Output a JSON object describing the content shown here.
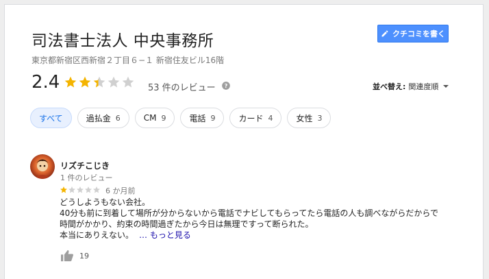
{
  "business": {
    "name": "司法書士法人 中央事務所",
    "address": "東京都新宿区西新宿２丁目６−１ 新宿住友ビル16階",
    "write_review_label": "クチコミを書く",
    "rating": "2.4",
    "rating_value": 2.4,
    "rating_max": 5,
    "review_count_label": "53 件のレビュー"
  },
  "sort": {
    "label": "並べ替え:",
    "value": "関連度順"
  },
  "chips": [
    {
      "label": "すべて",
      "count": "",
      "active": true
    },
    {
      "label": "過払金",
      "count": "6"
    },
    {
      "label": "CM",
      "count": "9"
    },
    {
      "label": "電話",
      "count": "9"
    },
    {
      "label": "カード",
      "count": "4"
    },
    {
      "label": "女性",
      "count": "3"
    }
  ],
  "review": {
    "author": "リズチこじき",
    "author_sub": "1 件のレビュー",
    "rating_value": 1,
    "date": "6 か月前",
    "lines": [
      "どうしようもない会社。",
      "40分も前に到着して場所が分からないから電話でナビしてもらってたら電話の人も調べながらだからで",
      "時間がかかり、約束の時間過ぎたから今日は無理ですって断られた。",
      "本当にありえない。"
    ],
    "more_label": "… もっと見る",
    "likes": "19"
  },
  "colors": {
    "star_filled": "#f4b400",
    "star_empty": "#d0d0d0",
    "primary_button": "#4d90fe",
    "link": "#1a0dab",
    "active_chip_bg": "#e8f0fe"
  }
}
